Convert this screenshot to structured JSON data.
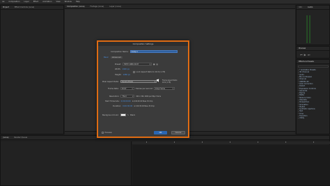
{
  "menu": [
    "Ae",
    "Composition",
    "Layer",
    "Effect",
    "Animation",
    "View",
    "Window",
    "Help"
  ],
  "project_panel": {
    "tab": "Project",
    "tab2": "Effect Controls (none)"
  },
  "viewer_tabs": [
    "Composition (none)",
    "Footage (none)",
    "Layer (none)"
  ],
  "right_top": {
    "tab1": "Info",
    "tab2": "Audio"
  },
  "preview_panel": {
    "tab": "Preview"
  },
  "effects_panel": {
    "tab": "Effects & Presets",
    "items": [
      "* Animation Presets",
      "3D Channel",
      "Audio",
      "Blur & Sharpen",
      "Channel",
      "CINEMA 4D",
      "Color Correction",
      "Distort",
      "Expression Controls",
      "Generate",
      "Keying",
      "Matte",
      "Noise & Grain",
      "Obsolete",
      "Perspective",
      "Simulation",
      "Stylize",
      "Synthetic Aperture",
      "Text",
      "Time",
      "Transition",
      "Utility"
    ]
  },
  "timeline": {
    "tab1": "(none)",
    "tab2": "Render Queue"
  },
  "dialog": {
    "title": "Composition Settings",
    "name_label": "Composition Name:",
    "name_value": "Comp 1",
    "tab_basic": "Basic",
    "tab_advanced": "Advanced",
    "preset_label": "Preset:",
    "preset_value": "HDTV 1080 29.97",
    "width_label": "Width:",
    "width_value": "1920 px",
    "height_label": "Height:",
    "height_value": "1080 px",
    "lock_label": "Lock Aspect Ratio to 16:9 (1.78)",
    "par_label": "Pixel Aspect Ratio:",
    "par_value": "Square Pixels",
    "frame_aspect_label": "Frame Aspect Ratio:",
    "frame_aspect_value": "16:9 (1.78)",
    "frame_rate_label": "Frame Rate:",
    "frame_rate_value": "29.97",
    "fps_label": "frames per second",
    "drop_frame": "Drop Frame",
    "resolution_label": "Resolution:",
    "resolution_value": "Third",
    "resolution_info": "640 x 360, 900K per 8bpc frame",
    "start_tc_label": "Start Timecode:",
    "start_tc_value": "0;00;00;00",
    "start_tc_info": "is 0;00;00;00  Base 30  drop",
    "duration_label": "Duration:",
    "duration_value": "0;00;30;00",
    "duration_info": "is 0;00;30;00  Base 30  drop",
    "bg_label": "Background Color:",
    "bg_name": "Black",
    "preview_label": "Preview",
    "ok": "OK",
    "cancel": "Cancel"
  },
  "colors": {
    "accent": "#e06c13",
    "ok_button": "#2a67b3",
    "link": "#4a8fe0"
  }
}
